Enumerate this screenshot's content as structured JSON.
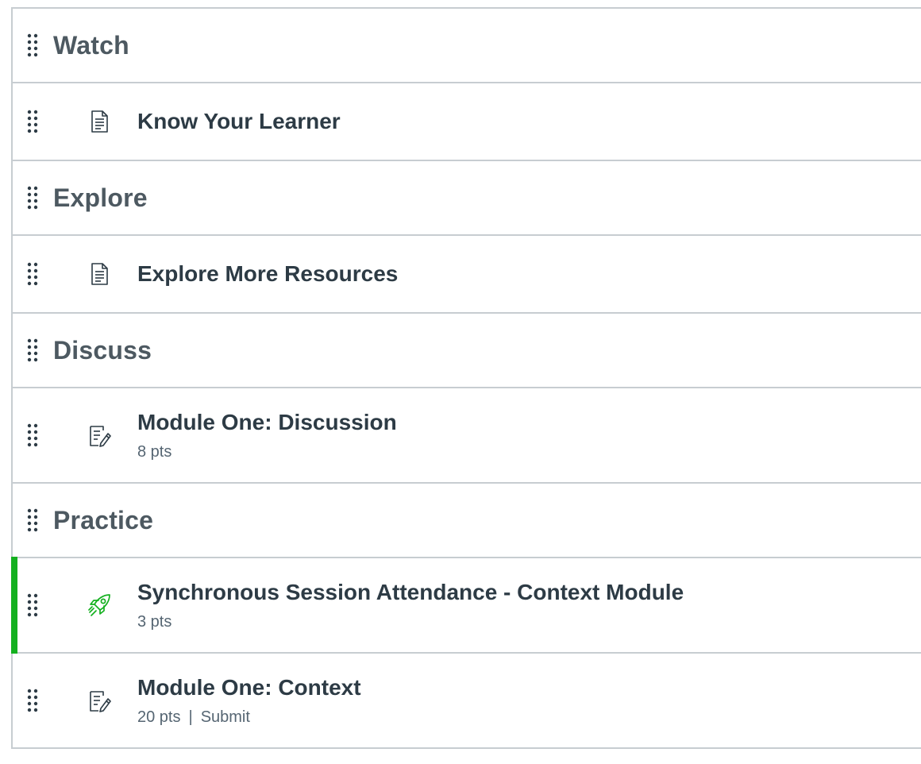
{
  "module": {
    "sections": [
      {
        "header": "Watch",
        "items": [
          {
            "title": "Know Your Learner",
            "icon": "page-icon"
          }
        ]
      },
      {
        "header": "Explore",
        "items": [
          {
            "title": "Explore More Resources",
            "icon": "page-icon"
          }
        ]
      },
      {
        "header": "Discuss",
        "items": [
          {
            "title": "Module One: Discussion",
            "icon": "assignment-icon",
            "points": "8 pts"
          }
        ]
      },
      {
        "header": "Practice",
        "items": [
          {
            "title": "Synchronous Session Attendance - Context Module",
            "icon": "rocket-icon",
            "points": "3 pts"
          },
          {
            "title": "Module One: Context",
            "icon": "assignment-icon",
            "points": "20 pts",
            "separator": "|",
            "action": "Submit"
          }
        ]
      }
    ]
  },
  "colors": {
    "published_bar": "#14b01f",
    "rocket_icon": "#14b01f",
    "border": "#c7cdd1",
    "header_text": "#4d5961",
    "title_text": "#2d3b45"
  }
}
